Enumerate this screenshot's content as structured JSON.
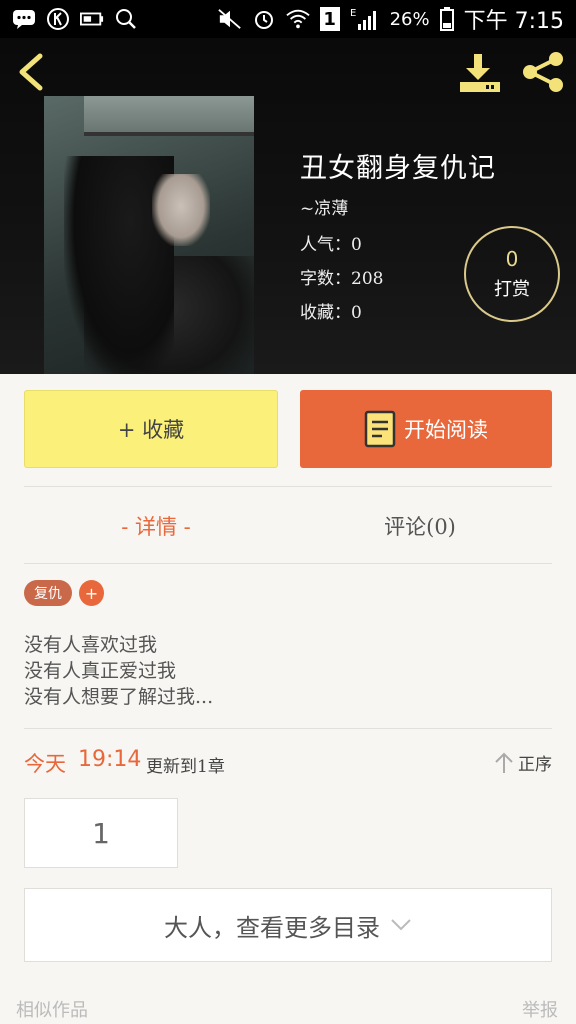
{
  "status_bar": {
    "battery": "26%",
    "time": "下午 7:15",
    "sim": "1",
    "net": "E"
  },
  "book": {
    "title": "丑女翻身复仇记",
    "author": "~凉薄",
    "popularity": "人气：0",
    "word_count": "字数：208",
    "favorites": "收藏：0"
  },
  "tip": {
    "count": "0",
    "label": "打赏"
  },
  "actions": {
    "favorite": "+ 收藏",
    "read": "开始阅读"
  },
  "tabs": {
    "detail": "- 详情 -",
    "comments": "评论(0)"
  },
  "tags": [
    "复仇",
    "+"
  ],
  "description": [
    "没有人喜欢过我",
    "没有人真正爱过我",
    "没有人想要了解过我..."
  ],
  "update": {
    "day": "今天",
    "time": "19:14",
    "info": "更新到1章",
    "sort": "正序"
  },
  "chapters": [
    "1"
  ],
  "more_catalog": "大人，查看更多目录",
  "footer": {
    "similar": "相似作品",
    "report": "举报"
  },
  "colors": {
    "accent": "#e8683b",
    "fav_yellow": "#fbf07a",
    "gold": "#e8d98f"
  }
}
